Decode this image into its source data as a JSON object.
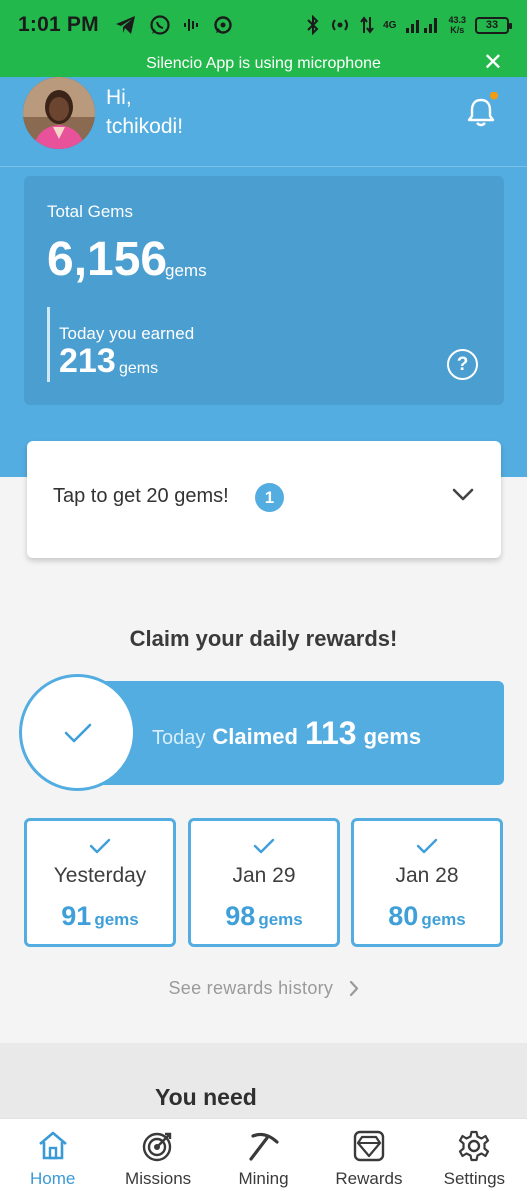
{
  "status_bar": {
    "time": "1:01 PM",
    "network": "4G",
    "speed_value": "43.3",
    "speed_unit": "K/s",
    "battery": "33",
    "icons": [
      "telegram-icon",
      "whatsapp-icon",
      "audio-icon",
      "chat-icon",
      "bluetooth-icon",
      "hotspot-icon",
      "data-arrows-icon",
      "signal-icon"
    ]
  },
  "mic_banner": {
    "text": "Silencio App is using microphone"
  },
  "header": {
    "greeting_line1": "Hi,",
    "greeting_line2": "tchikodi!",
    "notification_dot_color": "#f39c12"
  },
  "gems_card": {
    "label": "Total Gems",
    "total": "6,156",
    "total_unit": "gems",
    "today_label": "Today you earned",
    "today_value": "213",
    "today_unit": "gems",
    "help_symbol": "?"
  },
  "tap_card": {
    "text": "Tap to get 20 gems!",
    "badge_count": "1"
  },
  "daily": {
    "title": "Claim your daily rewards!",
    "today_label": "Today",
    "claimed_label": "Claimed",
    "claimed_value": "113",
    "claimed_unit": "gems",
    "days": [
      {
        "label": "Yesterday",
        "value": "91",
        "unit": "gems"
      },
      {
        "label": "Jan 29",
        "value": "98",
        "unit": "gems"
      },
      {
        "label": "Jan 28",
        "value": "80",
        "unit": "gems"
      }
    ],
    "history_link": "See rewards history"
  },
  "section": {
    "you_need": "You need"
  },
  "nav": [
    {
      "label": "Home",
      "icon": "home-icon",
      "active": true
    },
    {
      "label": "Missions",
      "icon": "target-icon",
      "active": false
    },
    {
      "label": "Mining",
      "icon": "pickaxe-icon",
      "active": false
    },
    {
      "label": "Rewards",
      "icon": "gem-icon",
      "active": false
    },
    {
      "label": "Settings",
      "icon": "gear-icon",
      "active": false
    }
  ],
  "colors": {
    "status_green": "#23b84c",
    "brand_blue": "#53ade0",
    "card_blue": "#4a9ed0"
  }
}
